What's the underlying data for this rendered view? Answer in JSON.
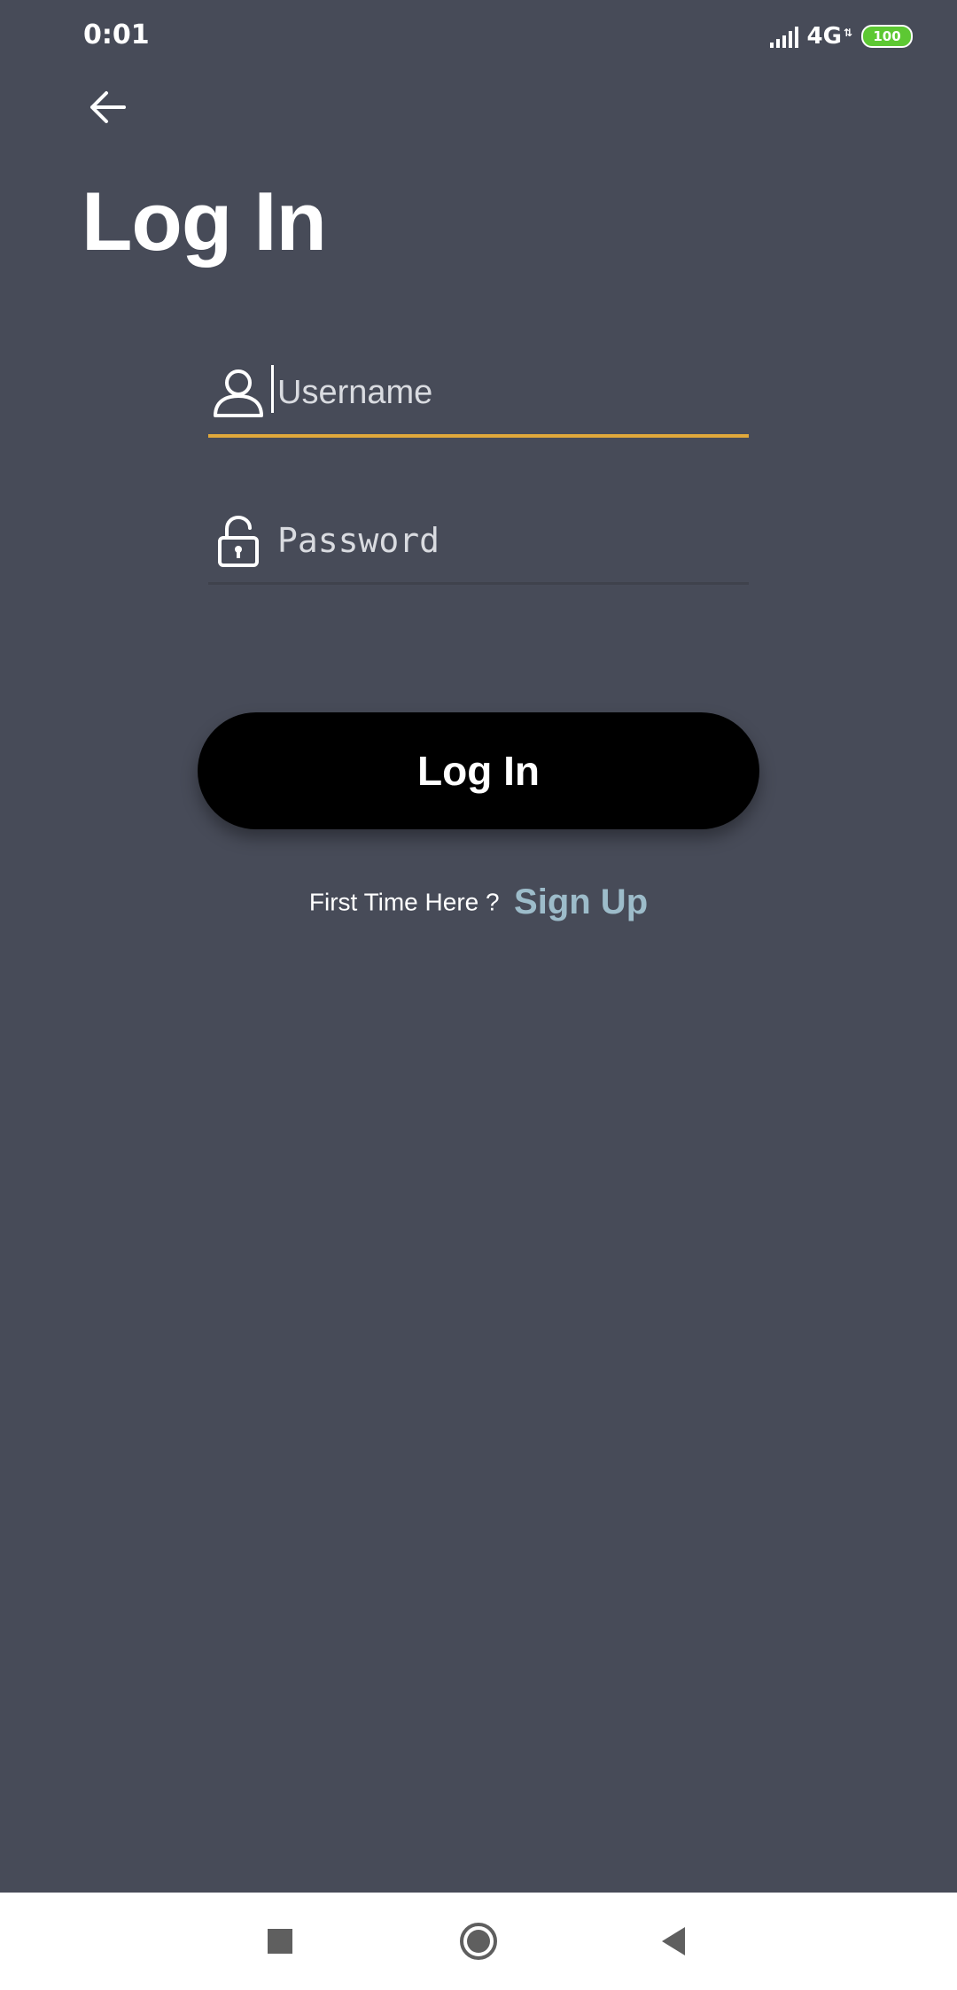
{
  "status_bar": {
    "time": "0:01",
    "network": "4G",
    "battery": "100",
    "battery_color": "#5dc833"
  },
  "header": {
    "back_icon": "arrow-left-icon",
    "title": "Log In"
  },
  "form": {
    "username": {
      "icon": "user-icon",
      "placeholder": "Username",
      "value": "",
      "underline_color": "#e0a83b"
    },
    "password": {
      "icon": "lock-open-icon",
      "placeholder": "Password",
      "value": ""
    },
    "submit_label": "Log In"
  },
  "signup": {
    "prompt": "First Time Here ?",
    "link_label": "Sign Up",
    "link_color": "#9dbcca"
  },
  "nav_bar": {
    "recents_icon": "square-icon",
    "home_icon": "circle-icon",
    "back_icon": "triangle-left-icon"
  },
  "colors": {
    "background": "#474b58",
    "button": "#000000"
  }
}
